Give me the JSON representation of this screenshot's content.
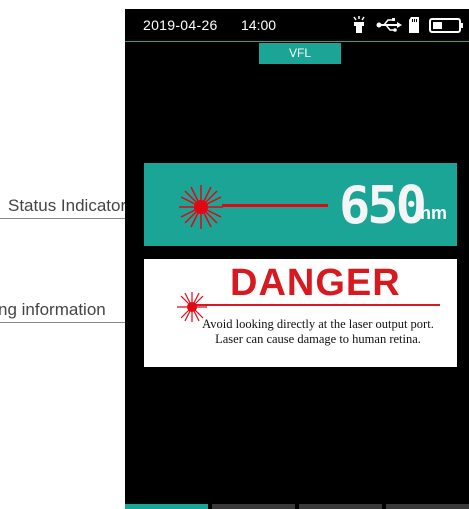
{
  "status_bar": {
    "date": "2019-04-26",
    "time": "14:00",
    "icons": [
      "flashlight-icon",
      "usb-icon",
      "sd-card-icon",
      "battery-icon"
    ]
  },
  "mode_tab": {
    "label": "VFL"
  },
  "indicator": {
    "wavelength_value": "650",
    "wavelength_unit": "nm",
    "color": "#1aa596"
  },
  "danger_box": {
    "title": "DANGER",
    "message": "Avoid looking directly at the laser output port. Laser can cause damage to human retina.",
    "color": "#d71920"
  },
  "callouts": {
    "status_indicator": "Status Indicator",
    "warning_information": "ng information"
  },
  "colors": {
    "accent": "#1aa596",
    "laser": "#e30613"
  }
}
